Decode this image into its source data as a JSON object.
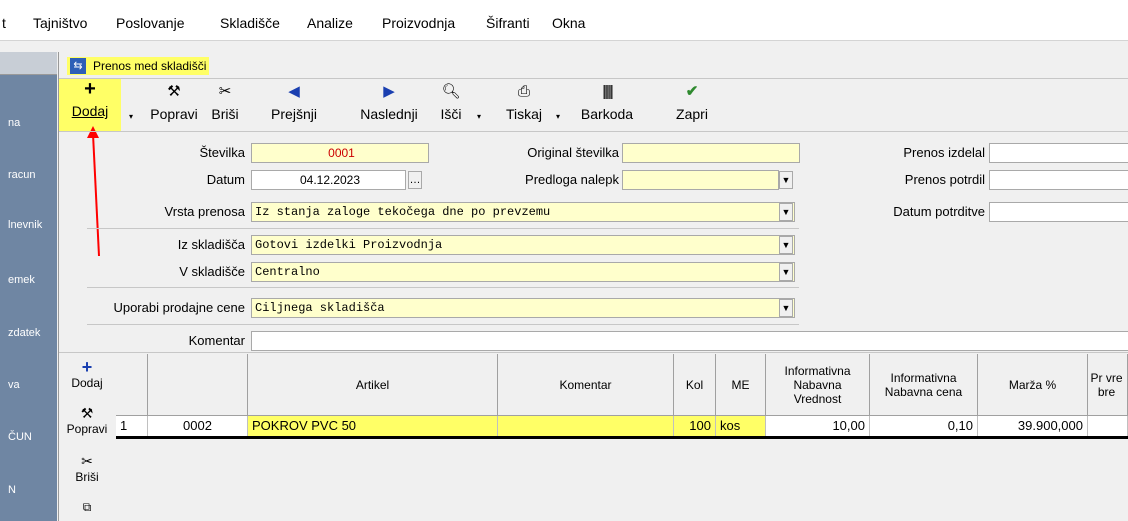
{
  "menu": [
    "t",
    "Tajništvo",
    "Poslovanje",
    "Skladišče",
    "Analize",
    "Proizvodnja",
    "Šifranti",
    "Okna"
  ],
  "left_panel": [
    "na",
    "racun",
    "lnevnik",
    "emek",
    "zdatek",
    "va",
    "ČUN",
    "N"
  ],
  "window": {
    "title": "Prenos med skladišči"
  },
  "toolbar": {
    "add": "Dodaj",
    "edit": "Popravi",
    "delete": "Briši",
    "prev": "Prejšnji",
    "next": "Naslednji",
    "search": "Išči",
    "print": "Tiskaj",
    "barcode": "Barkoda",
    "close": "Zapri"
  },
  "form": {
    "stevilka_label": "Številka",
    "stevilka_value": "0001",
    "datum_label": "Datum",
    "datum_value": "04.12.2023",
    "vrsta_label": "Vrsta prenosa",
    "vrsta_value": "Iz stanja zaloge tekočega dne po prevzemu",
    "iz_label": "Iz skladišča",
    "iz_value": "Gotovi izdelki     Proizvodnja",
    "v_label": "V skladišče",
    "v_value": "Centralno",
    "cene_label": "Uporabi prodajne cene",
    "cene_value": "Ciljnega skladišča",
    "komentar_label": "Komentar",
    "komentar_value": "",
    "orig_label": "Original številka",
    "orig_value": "",
    "predloga_label": "Predloga nalepk",
    "predloga_value": "",
    "izdelal_label": "Prenos izdelal",
    "izdelal_value": "",
    "potrdil_label": "Prenos potrdil",
    "potrdil_value": "",
    "datum_potrditve_label": "Datum potrditve",
    "datum_potrditve_value": ""
  },
  "grid": {
    "side_buttons": {
      "add": "Dodaj",
      "edit": "Popravi",
      "delete": "Briši"
    },
    "headers": [
      "Artikel",
      "Komentar",
      "Kol",
      "ME",
      "Informativna Nabavna Vrednost",
      "Informativna Nabavna cena",
      "Marža %",
      "Pr vre bre"
    ],
    "rows": [
      {
        "num": "1",
        "code": "0002",
        "artikel": "POKROV PVC 50",
        "komentar": "",
        "kol": "100",
        "me": "kos",
        "vrednost": "10,00",
        "cena": "0,10",
        "marza": "39.900,000",
        "extra": ""
      }
    ]
  },
  "colors": {
    "highlight": "#ffff66",
    "field_bg": "#ffffcc",
    "annotation_arrow": "#ff0000",
    "value_red": "#cc0000"
  }
}
